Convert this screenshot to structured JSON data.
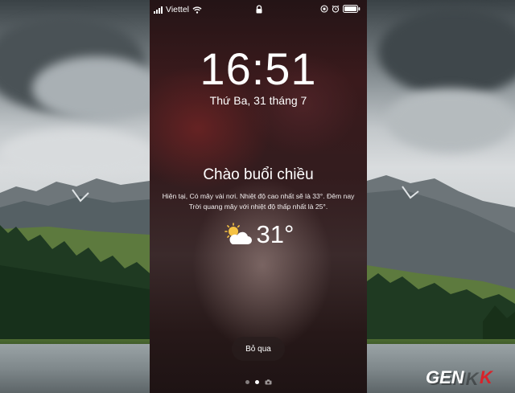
{
  "status_bar": {
    "carrier": "Viettel",
    "icons": [
      "signal-icon",
      "wifi-icon",
      "lock-icon",
      "orientation-lock-icon",
      "alarm-icon",
      "battery-icon"
    ]
  },
  "lock_screen": {
    "time": "16:51",
    "date": "Thứ Ba, 31 tháng 7"
  },
  "weather_card": {
    "greeting": "Chào buổi chiều",
    "forecast_line1": "Hiện tại, Có mây vài nơi. Nhiệt độ cao nhất sẽ là 33°. Đêm nay",
    "forecast_line2": "Trời quang mây với nhiệt độ thấp nhất là 25°.",
    "condition_icon": "partly-cloudy-icon",
    "temperature": "31°"
  },
  "skip_button": {
    "label": "Bỏ qua"
  },
  "page_indicator": {
    "pages": 3,
    "active_page": 2,
    "last_item_icon": "camera-icon"
  },
  "watermark": {
    "text": "GENK"
  },
  "colors": {
    "accent_sun": "#f5c243",
    "text": "#ffffff",
    "watermark_red": "#d8232a"
  }
}
